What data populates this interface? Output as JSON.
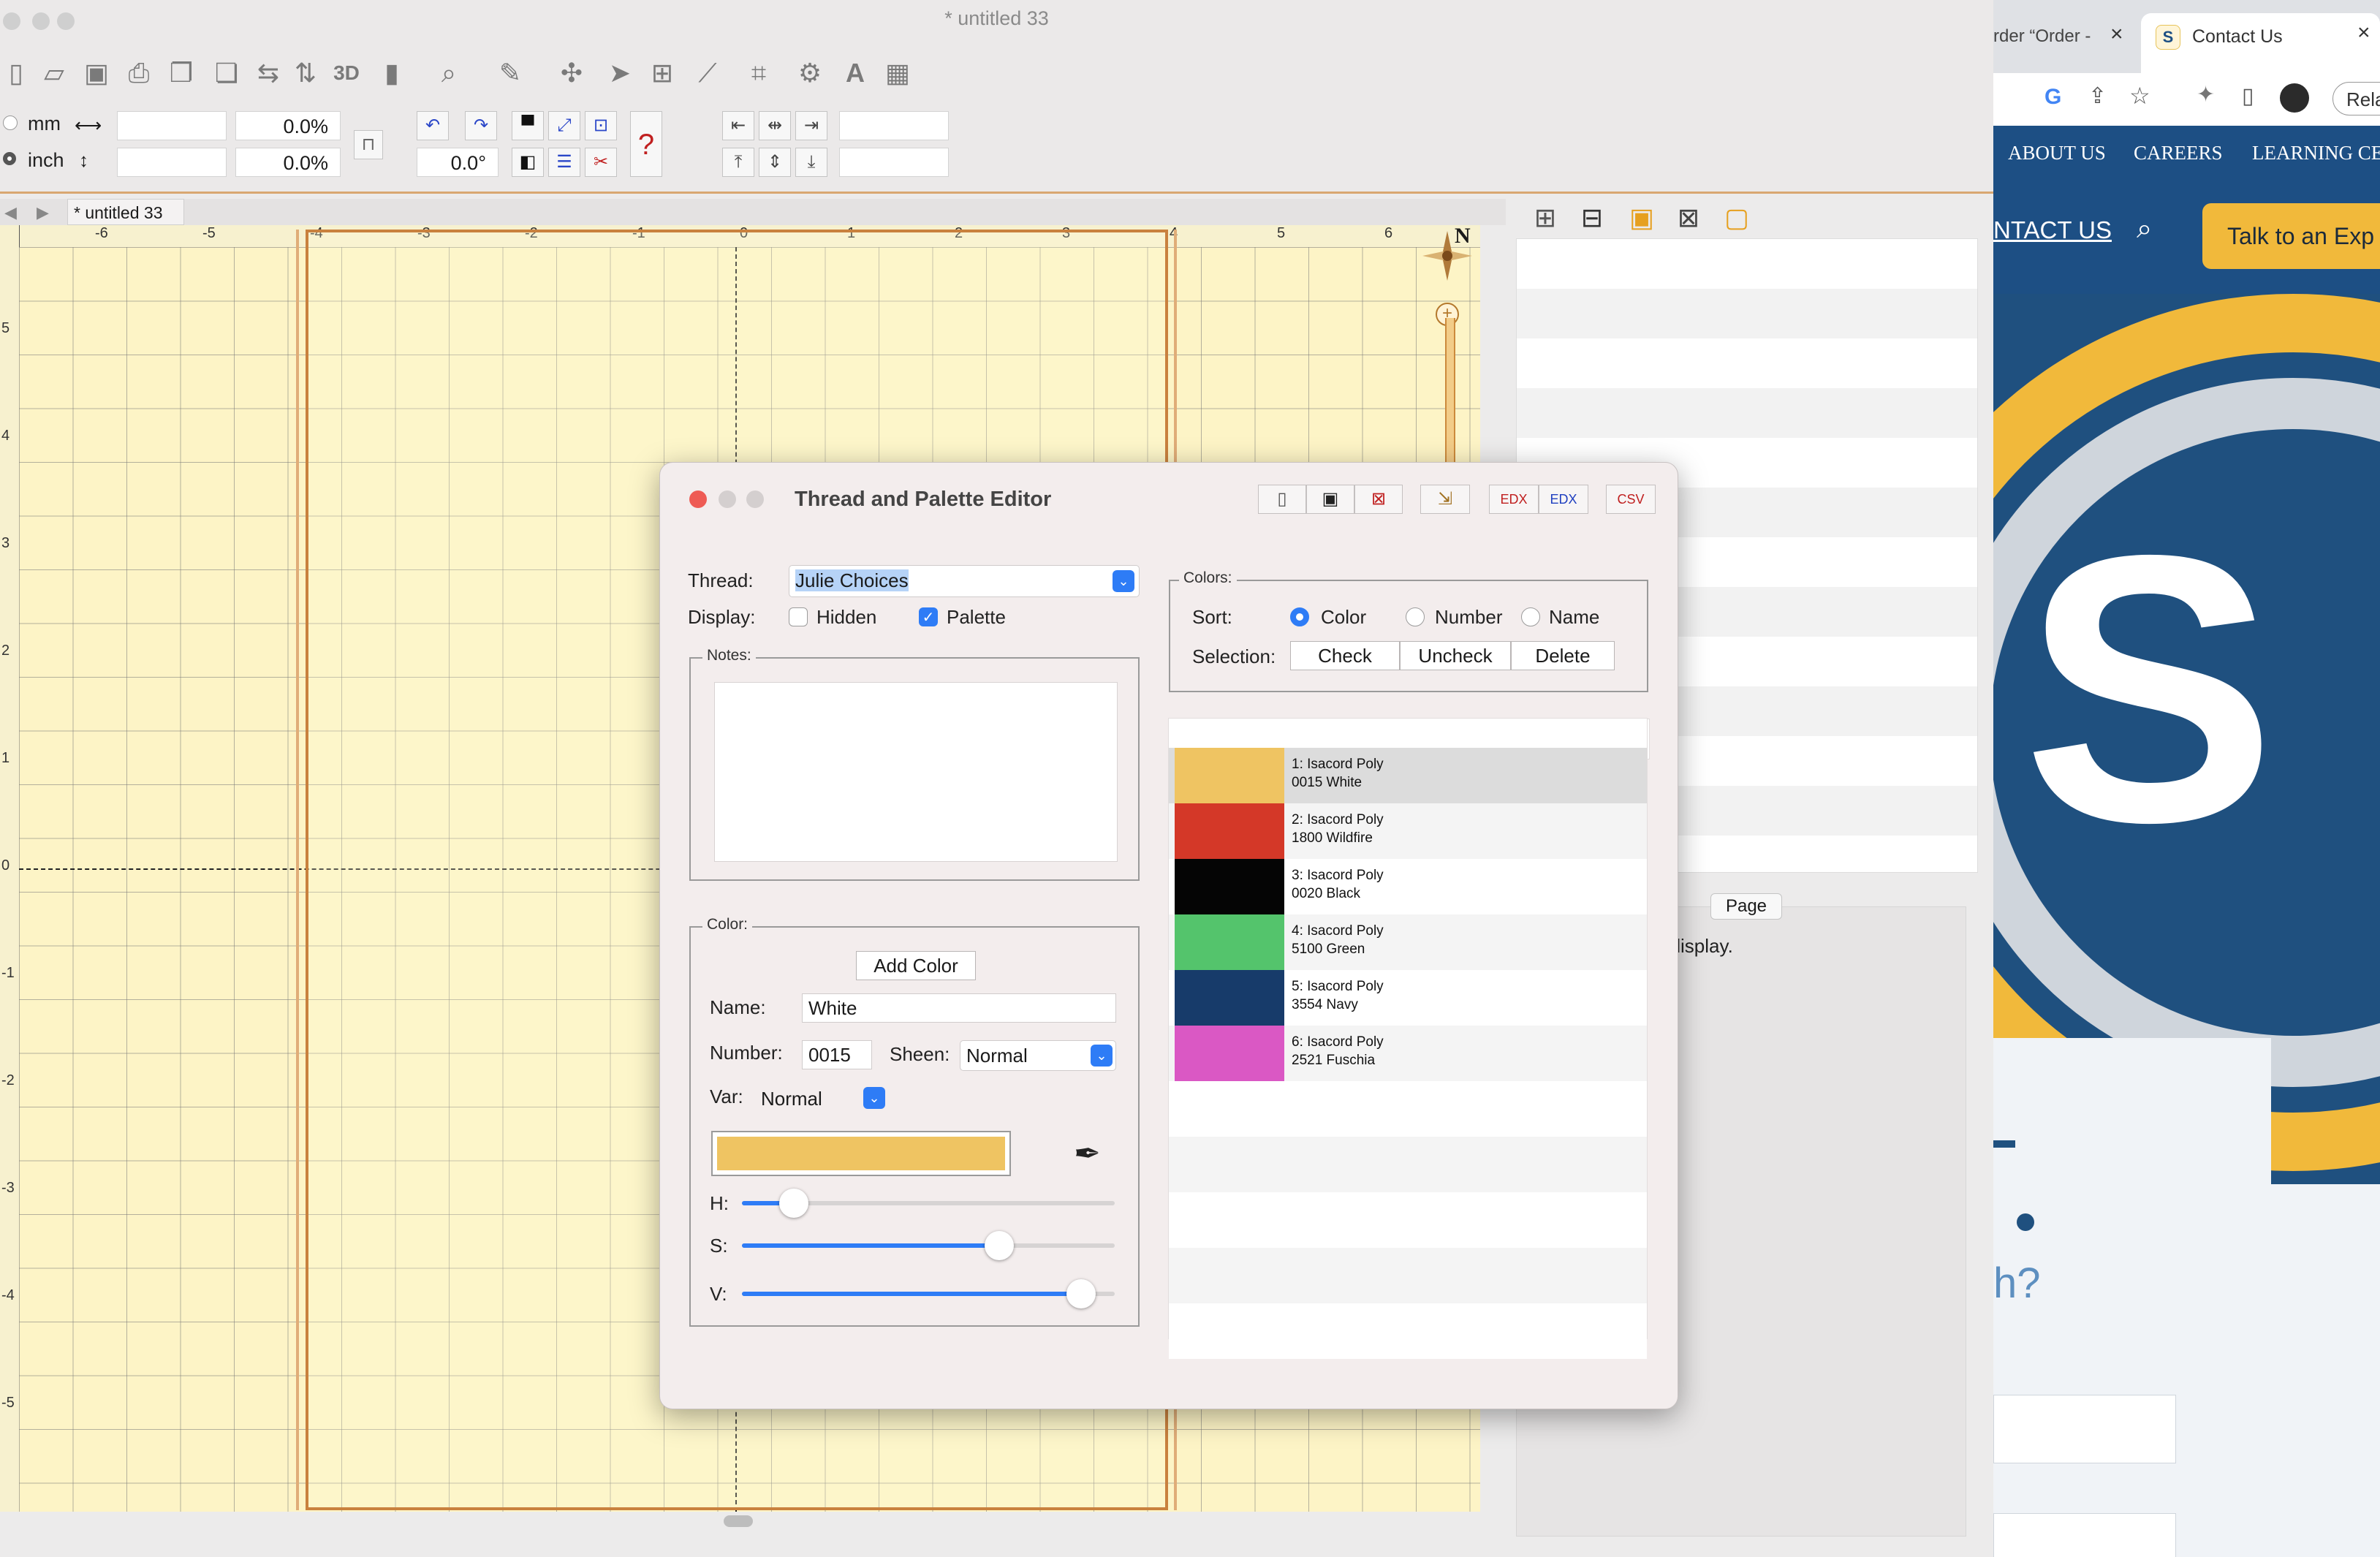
{
  "app": {
    "window_title": "* untitled 33",
    "units": {
      "mm_label": "mm",
      "inch_label": "inch"
    },
    "fields": {
      "width_pct": "0.0%",
      "height_pct": "0.0%",
      "rotation": "0.0°"
    },
    "doc_tab": "* untitled 33",
    "ruler_top_labels": [
      "-6",
      "-5",
      "-4",
      "-3",
      "-2",
      "-1",
      "0",
      "1",
      "2",
      "3",
      "4",
      "5",
      "6"
    ],
    "ruler_left_labels": [
      "5",
      "4",
      "3",
      "2",
      "1",
      "0",
      "-1",
      "-2",
      "-3",
      "-4",
      "-5"
    ],
    "compass_label": "N",
    "properties_message": "e no properties to display.",
    "page_button": "Page",
    "toolbar_icons": [
      "new-icon",
      "open-icon",
      "save-icon",
      "print-icon",
      "copy-icon",
      "paste-icon",
      "mirror-h-icon",
      "mirror-v-icon",
      "3d-icon",
      "stats-icon",
      "zoom-icon",
      "ruler-icon",
      "compass-icon",
      "pointer-icon",
      "node-icon",
      "stitch-icon",
      "wireframe-icon",
      "gear-icon",
      "text-icon",
      "camera-icon"
    ]
  },
  "dialog": {
    "title": "Thread and Palette Editor",
    "thread_label": "Thread:",
    "thread_value": "Julie Choices",
    "display_label": "Display:",
    "hidden_label": "Hidden",
    "hidden_checked": false,
    "palette_label": "Palette",
    "palette_checked": true,
    "notes_label": "Notes:",
    "colors_group_label": "Colors:",
    "sort_label": "Sort:",
    "sort_options": [
      "Color",
      "Number",
      "Name"
    ],
    "sort_selected": "Color",
    "selection_label": "Selection:",
    "selection_buttons": [
      "Check",
      "Uncheck",
      "Delete"
    ],
    "color_group_label": "Color:",
    "add_color": "Add Color",
    "name_label": "Name:",
    "name_value": "White",
    "number_label": "Number:",
    "number_value": "0015",
    "sheen_label": "Sheen:",
    "sheen_value": "Normal",
    "var_label": "Var:",
    "var_value": "Normal",
    "preview_color": "#efc462",
    "h_label": "H:",
    "s_label": "S:",
    "v_label": "V:",
    "h_value": 0.14,
    "s_value": 0.69,
    "v_value": 0.91,
    "threads": [
      {
        "line1": "1: Isacord Poly",
        "line2": "0015 White",
        "color": "#efc462",
        "selected": true
      },
      {
        "line1": "2: Isacord Poly",
        "line2": "1800 Wildfire",
        "color": "#d43828"
      },
      {
        "line1": "3: Isacord Poly",
        "line2": "0020 Black",
        "color": "#050505"
      },
      {
        "line1": "4: Isacord Poly",
        "line2": "5100 Green",
        "color": "#54c46c"
      },
      {
        "line1": "5: Isacord Poly",
        "line2": "3554 Navy",
        "color": "#173b6a"
      },
      {
        "line1": "6: Isacord Poly",
        "line2": "2521 Fuschia",
        "color": "#da58c4"
      }
    ]
  },
  "browser": {
    "tab_inactive": "rder “Order -",
    "tab_active": "Contact Us",
    "relaunch": "Rela",
    "nav_links": [
      "ABOUT US",
      "CAREERS",
      "LEARNING CE"
    ],
    "contact_link": "NTACT US",
    "talk_button": "Talk to an Exp",
    "hero_text": "h?",
    "colors": {
      "navy": "#1d4f84",
      "gold": "#f1b93b"
    }
  }
}
